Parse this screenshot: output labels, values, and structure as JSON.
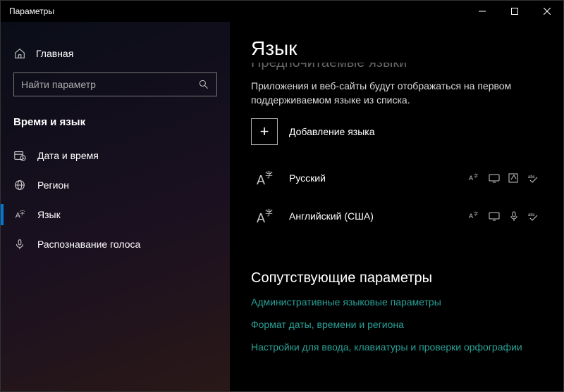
{
  "titlebar": {
    "title": "Параметры"
  },
  "sidebar": {
    "home": "Главная",
    "search_placeholder": "Найти параметр",
    "category": "Время и язык",
    "items": [
      {
        "label": "Дата и время"
      },
      {
        "label": "Регион"
      },
      {
        "label": "Язык"
      },
      {
        "label": "Распознавание голоса"
      }
    ]
  },
  "main": {
    "title": "Язык",
    "section_cut": "Предпочитаемые языки",
    "description": "Приложения и веб-сайты будут отображаться на первом поддерживаемом языке из списка.",
    "add_language": "Добавление языка",
    "languages": [
      {
        "name": "Русский",
        "features": [
          "tts",
          "display",
          "handwrite",
          "spell"
        ]
      },
      {
        "name": "Английский (США)",
        "features": [
          "tts",
          "display",
          "mic",
          "spell"
        ]
      }
    ],
    "related": {
      "title": "Сопутствующие параметры",
      "links": [
        "Административные языковые параметры",
        "Формат даты, времени и региона",
        "Настройки для ввода, клавиатуры и проверки орфографии"
      ]
    }
  }
}
